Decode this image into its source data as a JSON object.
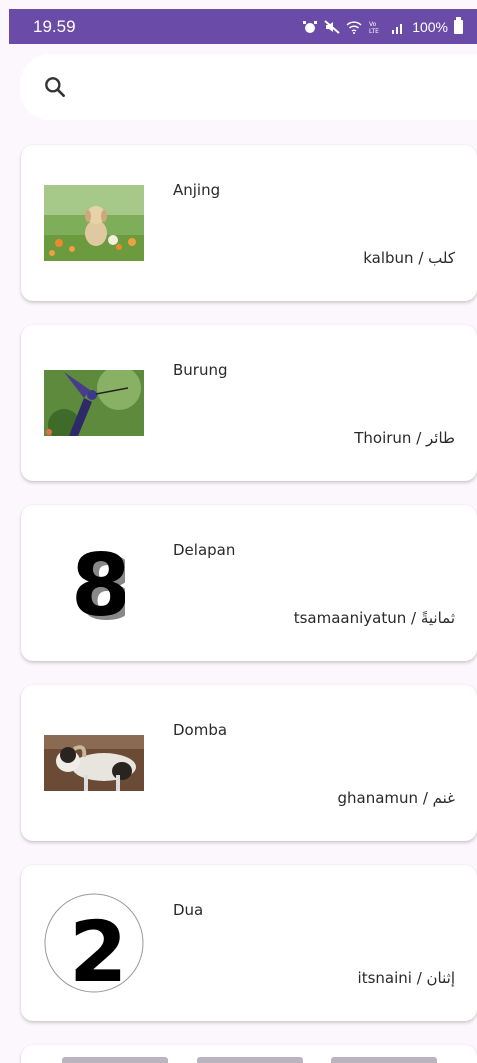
{
  "status_bar": {
    "time": "19.59",
    "battery": "100%",
    "icons": [
      "alarm-icon",
      "mute-icon",
      "wifi-icon",
      "volte-icon",
      "signal-icon",
      "battery-icon"
    ],
    "color": "#6a4ba8"
  },
  "search": {
    "placeholder": "",
    "icon": "search-icon"
  },
  "cards": [
    {
      "title": "Anjing",
      "translation": "kalbun / كلب",
      "image": "dog-photo"
    },
    {
      "title": "Burung",
      "translation": "Thoirun / طائر",
      "image": "hummingbird-photo"
    },
    {
      "title": "Delapan",
      "translation": "tsamaaniyatun / ثمانيةً",
      "image": "number-eight-graphic"
    },
    {
      "title": "Domba",
      "translation": "ghanamun / غنم",
      "image": "sheep-photo"
    },
    {
      "title": "Dua",
      "translation": "itsnaini / إثنان",
      "image": "number-two-graphic"
    }
  ]
}
